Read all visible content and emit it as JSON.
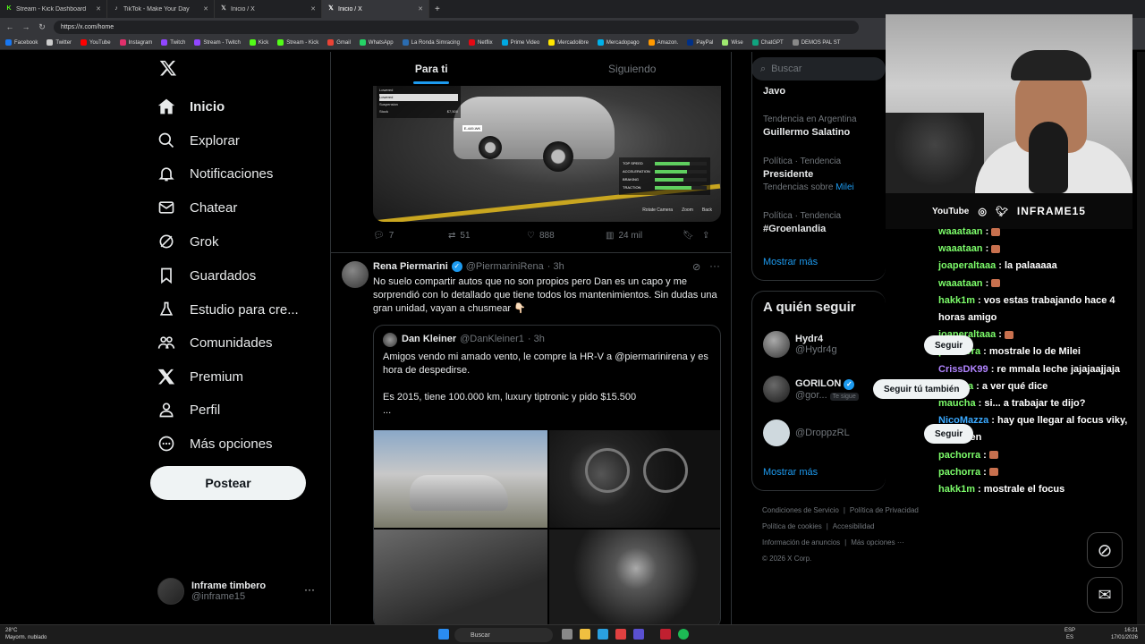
{
  "browser": {
    "tabs": [
      {
        "title": "Stream - Kick Dashboard",
        "icon": "kick-icon",
        "active": false
      },
      {
        "title": "TikTok - Make Your Day",
        "icon": "tiktok-icon",
        "active": false
      },
      {
        "title": "Inicio / X",
        "icon": "x-icon",
        "active": false
      },
      {
        "title": "Inicio / X",
        "icon": "x-icon",
        "active": true
      }
    ],
    "new_tab": "+",
    "url": "https://x.com/home",
    "bookmarks": [
      "Facebook",
      "Twitter",
      "YouTube",
      "Instagram",
      "Twitch",
      "Stream - Twitch",
      "Kick",
      "Stream - Kick",
      "Gmail",
      "WhatsApp",
      "La Ronda Simracing",
      "Netflix",
      "Prime Video",
      "Mercadolibre",
      "Mercadopago",
      "Amazon.",
      "PayPal",
      "Wise",
      "ChatGPT",
      "DEMOS PAL ST"
    ],
    "bookmark_colors": [
      "#1877f2",
      "#cccccc",
      "#ff0000",
      "#e1306c",
      "#9146ff",
      "#9146ff",
      "#53fc18",
      "#53fc18",
      "#ea4335",
      "#25d366",
      "#2b6cb0",
      "#e50914",
      "#00a8e1",
      "#ffe600",
      "#00b1ea",
      "#ff9900",
      "#003087",
      "#9fe870",
      "#10a37f",
      "#888888"
    ]
  },
  "nav": {
    "items": [
      {
        "label": "Inicio",
        "icon": "home-icon",
        "bold": true
      },
      {
        "label": "Explorar",
        "icon": "search-icon",
        "bold": false
      },
      {
        "label": "Notificaciones",
        "icon": "bell-icon",
        "bold": false
      },
      {
        "label": "Chatear",
        "icon": "mail-icon",
        "bold": false
      },
      {
        "label": "Grok",
        "icon": "grok-icon",
        "bold": false
      },
      {
        "label": "Guardados",
        "icon": "bookmark-icon",
        "bold": false
      },
      {
        "label": "Estudio para cre...",
        "icon": "creator-studio-icon",
        "bold": false
      },
      {
        "label": "Comunidades",
        "icon": "communities-icon",
        "bold": false
      },
      {
        "label": "Premium",
        "icon": "x-icon",
        "bold": false
      },
      {
        "label": "Perfil",
        "icon": "person-icon",
        "bold": false
      },
      {
        "label": "Más opciones",
        "icon": "more-circle-icon",
        "bold": false
      }
    ],
    "post_label": "Postear",
    "account": {
      "name": "Inframe timbero",
      "handle": "@inframe15",
      "more": "···"
    }
  },
  "feed": {
    "tabs": [
      {
        "label": "Para ti",
        "active": true
      },
      {
        "label": "Siguiendo",
        "active": false
      }
    ],
    "tweet1": {
      "game_menu": [
        "Lowered",
        "Lowered",
        "Suspension",
        "Stock",
        "$7,500"
      ],
      "game_stats": [
        {
          "label": "TOP SPEED",
          "level": 0.68
        },
        {
          "label": "ACCELERATION",
          "level": 0.62
        },
        {
          "label": "BRAKING",
          "level": 0.55
        },
        {
          "label": "TRACTION",
          "level": 0.7
        }
      ],
      "game_hints": [
        "Rotate Camera",
        "Zoom",
        "Back"
      ],
      "plate": "E-449-WK",
      "replies": "7",
      "reposts": "51",
      "likes": "888",
      "views": "24 mil"
    },
    "tweet2": {
      "name": "Rena Piermarini",
      "handle": "@PiermariniRena",
      "time": "· 3h",
      "text": "No suelo compartir autos que no son propios pero Dan es un capo y me sorprendió con lo detallado que tiene todos los mantenimientos. Sin dudas una gran unidad, vayan a chusmear 👇🏻",
      "quote": {
        "name": "Dan Kleiner",
        "handle": "@DanKleiner1",
        "time": "· 3h",
        "text": "Amigos vendo mi amado vento, le compre la HR-V a @piermarinirena y es hora de despedirse.\n\nEs 2015, tiene 100.000 km, luxury tiptronic y pido $15.500\n..."
      }
    }
  },
  "right": {
    "search_placeholder": "Buscar",
    "trends": [
      {
        "meta": "",
        "name": "Javo",
        "sub": "",
        "sub_link": ""
      },
      {
        "meta": "Tendencia en Argentina",
        "name": "Guillermo Salatino",
        "sub": "",
        "sub_link": ""
      },
      {
        "meta": "Política · Tendencia",
        "name": "Presidente",
        "sub": "Tendencias sobre ",
        "sub_link": "Milei"
      },
      {
        "meta": "Política · Tendencia",
        "name": "#Groenlandia",
        "sub": "",
        "sub_link": ""
      }
    ],
    "show_more": "Mostrar más",
    "who_title": "A quién seguir",
    "who": [
      {
        "name": "Hydr4",
        "handle": "@Hydr4g",
        "follows_you": "",
        "button": "Seguir"
      },
      {
        "name": "GORILON",
        "handle": "@gor...",
        "follows_you": "Te sigue",
        "button": "Seguir tú también"
      },
      {
        "name": "",
        "handle": "@DroppzRL",
        "follows_you": "",
        "button": "Seguir"
      }
    ],
    "show_more_2": "Mostrar más",
    "footer_links": [
      "Condiciones de Servicio",
      "Política de Privacidad",
      "Política de cookies",
      "Accesibilidad",
      "Información de anuncios",
      "Más opciones ···"
    ],
    "copyright": "© 2026 X Corp."
  },
  "stream": {
    "youtube": "YouTube",
    "handle": "INFRAME15",
    "chat": [
      {
        "user": "waaataan",
        "text": "",
        "emote": true,
        "color": "c1"
      },
      {
        "user": "waaataan",
        "text": "",
        "emote": true,
        "color": "c1"
      },
      {
        "user": "joaperaltaaa",
        "text": "la palaaaaa",
        "emote": false,
        "color": "c1"
      },
      {
        "user": "waaataan",
        "text": "",
        "emote": true,
        "color": "c1"
      },
      {
        "user": "hakk1m",
        "text": "vos estas trabajando hace 4 horas amigo",
        "emote": false,
        "color": "c1"
      },
      {
        "user": "joaperaltaaa",
        "text": "",
        "emote": true,
        "color": "c1"
      },
      {
        "user": "pachorra",
        "text": "mostrale lo de Milei",
        "emote": false,
        "color": "c1"
      },
      {
        "user": "CrissDK99",
        "text": "re mmala leche jajajaajjaja",
        "emote": false,
        "color": "c2"
      },
      {
        "user": "patoma",
        "text": "a ver qué dice",
        "emote": false,
        "color": "c1"
      },
      {
        "user": "maucha",
        "text": "si... a trabajar te dijo?",
        "emote": false,
        "color": "c1"
      },
      {
        "user": "NicoMazza",
        "text": "hay que llegar al focus viky, muy bien",
        "emote": false,
        "color": "c3"
      },
      {
        "user": "pachorra",
        "text": "",
        "emote": true,
        "color": "c1"
      },
      {
        "user": "pachorra",
        "text": "",
        "emote": true,
        "color": "c1"
      },
      {
        "user": "hakk1m",
        "text": "mostrale el focus",
        "emote": false,
        "color": "c1"
      }
    ]
  },
  "taskbar": {
    "temp": "28°C",
    "weather": "Mayorm. nublado",
    "search": "Buscar",
    "lang": "ESP",
    "lang2": "ES",
    "time": "16:21",
    "date": "17/01/2026"
  },
  "colors": {
    "accent": "#1d9bf0",
    "kick": "#53fc18",
    "bg": "#000000"
  }
}
